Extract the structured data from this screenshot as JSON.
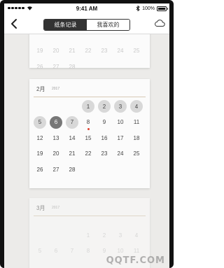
{
  "status_bar": {
    "time": "9:41 AM",
    "battery_text": "100%"
  },
  "nav": {
    "tabs": [
      {
        "label": "纸条记录",
        "active": true
      },
      {
        "label": "我喜欢的",
        "active": false
      }
    ]
  },
  "months": [
    {
      "name": "",
      "year": "",
      "rows": [
        [
          "",
          "",
          "",
          "",
          "",
          "",
          ""
        ],
        [
          "19",
          "20",
          "21",
          "22",
          "23",
          "24",
          "25"
        ],
        [
          "26",
          "27",
          "28",
          "",
          "",
          "",
          ""
        ]
      ]
    },
    {
      "name": "2月",
      "year": "2017",
      "days": [
        [
          "",
          "",
          "",
          "1",
          "2",
          "3",
          "4"
        ],
        [
          "5",
          "6",
          "7",
          "8",
          "9",
          "10",
          "11"
        ],
        [
          "12",
          "13",
          "14",
          "15",
          "16",
          "17",
          "18"
        ],
        [
          "19",
          "20",
          "21",
          "22",
          "23",
          "24",
          "25"
        ],
        [
          "26",
          "27",
          "28",
          "",
          "",
          "",
          ""
        ]
      ],
      "selected_day": "6",
      "marked_day": "8"
    },
    {
      "name": "3月",
      "year": "2017",
      "days": [
        [
          "",
          "",
          "",
          "1",
          "2",
          "3",
          "4"
        ],
        [
          "5",
          "6",
          "7",
          "8",
          "9",
          "10",
          "11"
        ]
      ]
    }
  ],
  "watermark": "QQTF.COM",
  "icons": {
    "back": "chevron-left-icon",
    "cloud": "cloud-icon"
  },
  "colors": {
    "selected": "#777777",
    "circle": "#d8d8d8",
    "dot": "#e0402e",
    "header_line": "#d8c9b5"
  }
}
